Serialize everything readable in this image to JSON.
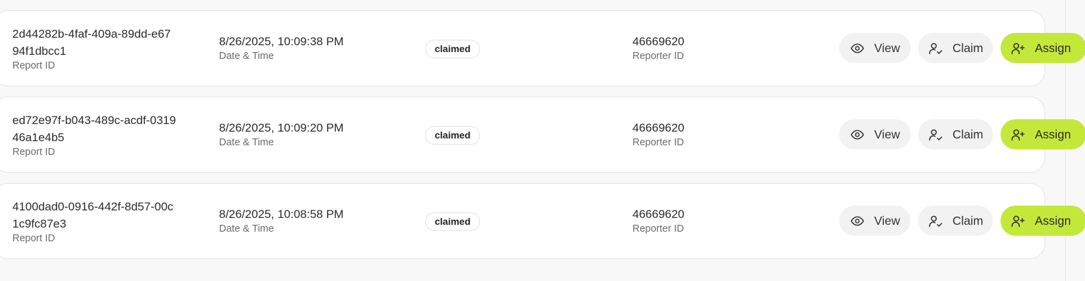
{
  "rows": [
    {
      "report_id": "2d44282b-4faf-409a-89dd-e6794f1dbcc1",
      "report_id_label": "Report ID",
      "datetime": "8/26/2025, 10:09:38 PM",
      "datetime_label": "Date & Time",
      "status": "claimed",
      "reporter_id": "46669620",
      "reporter_id_label": "Reporter ID",
      "view_label": "View",
      "claim_label": "Claim",
      "assign_label": "Assign"
    },
    {
      "report_id": "ed72e97f-b043-489c-acdf-031946a1e4b5",
      "report_id_label": "Report ID",
      "datetime": "8/26/2025, 10:09:20 PM",
      "datetime_label": "Date & Time",
      "status": "claimed",
      "reporter_id": "46669620",
      "reporter_id_label": "Reporter ID",
      "view_label": "View",
      "claim_label": "Claim",
      "assign_label": "Assign"
    },
    {
      "report_id": "4100dad0-0916-442f-8d57-00c1c9fc87e3",
      "report_id_label": "Report ID",
      "datetime": "8/26/2025, 10:08:58 PM",
      "datetime_label": "Date & Time",
      "status": "claimed",
      "reporter_id": "46669620",
      "reporter_id_label": "Reporter ID",
      "view_label": "View",
      "claim_label": "Claim",
      "assign_label": "Assign"
    }
  ],
  "icons": {
    "view": "eye-icon",
    "claim": "user-check-icon",
    "assign": "user-plus-icon"
  },
  "colors": {
    "assign_accent": "#c4e83a",
    "secondary_button_bg": "#f2f2f2",
    "card_border": "#e4e4e4",
    "page_bg": "#f8f8f8"
  }
}
